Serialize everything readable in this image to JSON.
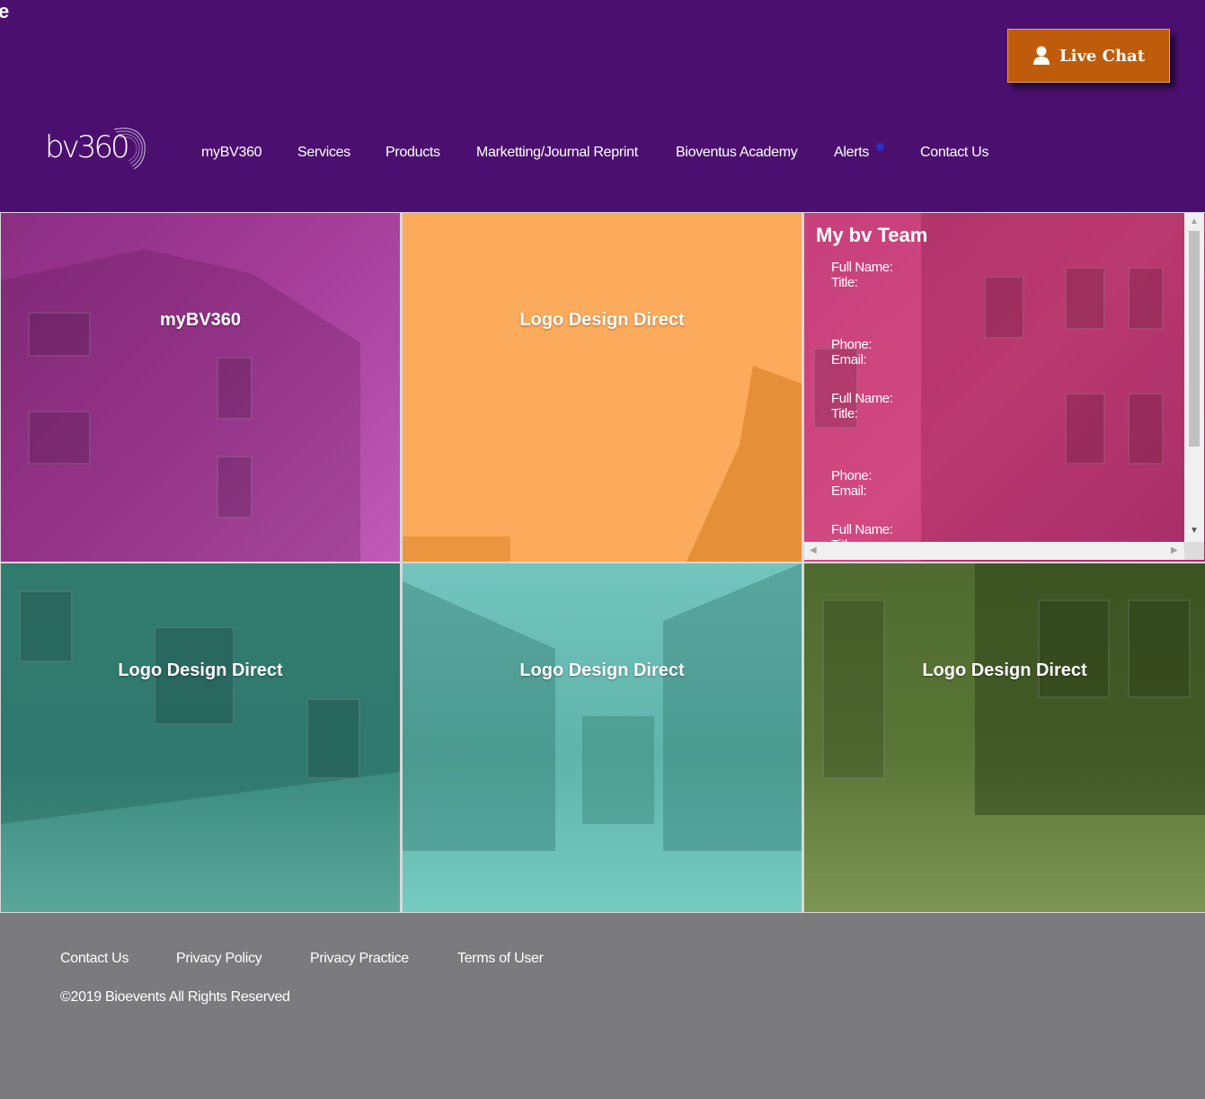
{
  "header": {
    "stray_char": "e",
    "live_chat": "Live Chat",
    "logo_text": "bv360",
    "nav": [
      {
        "label": "myBV360"
      },
      {
        "label": "Services"
      },
      {
        "label": "Products"
      },
      {
        "label": "Marketting/Journal Reprint"
      },
      {
        "label": "Bioventus Academy"
      },
      {
        "label": "Alerts"
      },
      {
        "label": "Contact Us"
      }
    ]
  },
  "tiles": [
    {
      "title": "myBV360",
      "color": "#b0419f"
    },
    {
      "title": "Logo Design Direct",
      "color": "#fbaa5a"
    },
    {
      "title": "Logo Design Direct",
      "color": "#3a8f84"
    },
    {
      "title": "Logo Design Direct",
      "color": "#6fc5bd"
    },
    {
      "title": "Logo Design Direct",
      "color": "#5f7a38"
    }
  ],
  "team": {
    "title": "My bv Team",
    "entries": [
      {
        "name_label": "Full Name:",
        "title_label": "Title:",
        "phone_label": "Phone:",
        "email_label": "Email:"
      },
      {
        "name_label": "Full Name:",
        "title_label": "Title:",
        "phone_label": "Phone:",
        "email_label": "Email:"
      },
      {
        "name_label": "Full Name:",
        "title_label": "Title:"
      }
    ],
    "color": "#c93d7b"
  },
  "footer": {
    "links": [
      "Contact Us",
      "Privacy Policy",
      "Privacy Practice",
      "Terms of User"
    ],
    "copyright": "©2019 Bioevents All Rights Reserved"
  }
}
